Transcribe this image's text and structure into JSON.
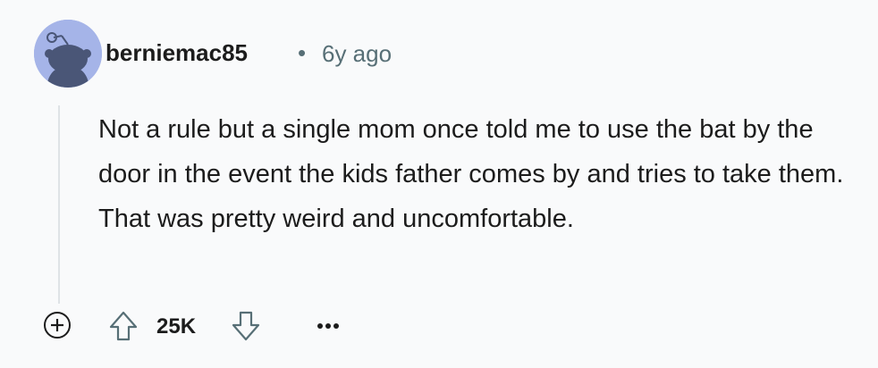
{
  "comment": {
    "author": "berniemac85",
    "separator": "•",
    "timestamp": "6y ago",
    "body": "Not a rule but a single mom once told me to use the bat by the door in the event the kids father comes by and tries to take them. That was pretty weird and uncomfortable.",
    "avatar_icon": "default-snoo-avatar-icon",
    "avatar_color": "#a5b4e8"
  },
  "actions": {
    "expand_icon": "plus-circle-icon",
    "upvote_icon": "arrow-up-outline-icon",
    "score": "25K",
    "downvote_icon": "arrow-down-outline-icon",
    "more_icon": "ellipsis-icon"
  }
}
